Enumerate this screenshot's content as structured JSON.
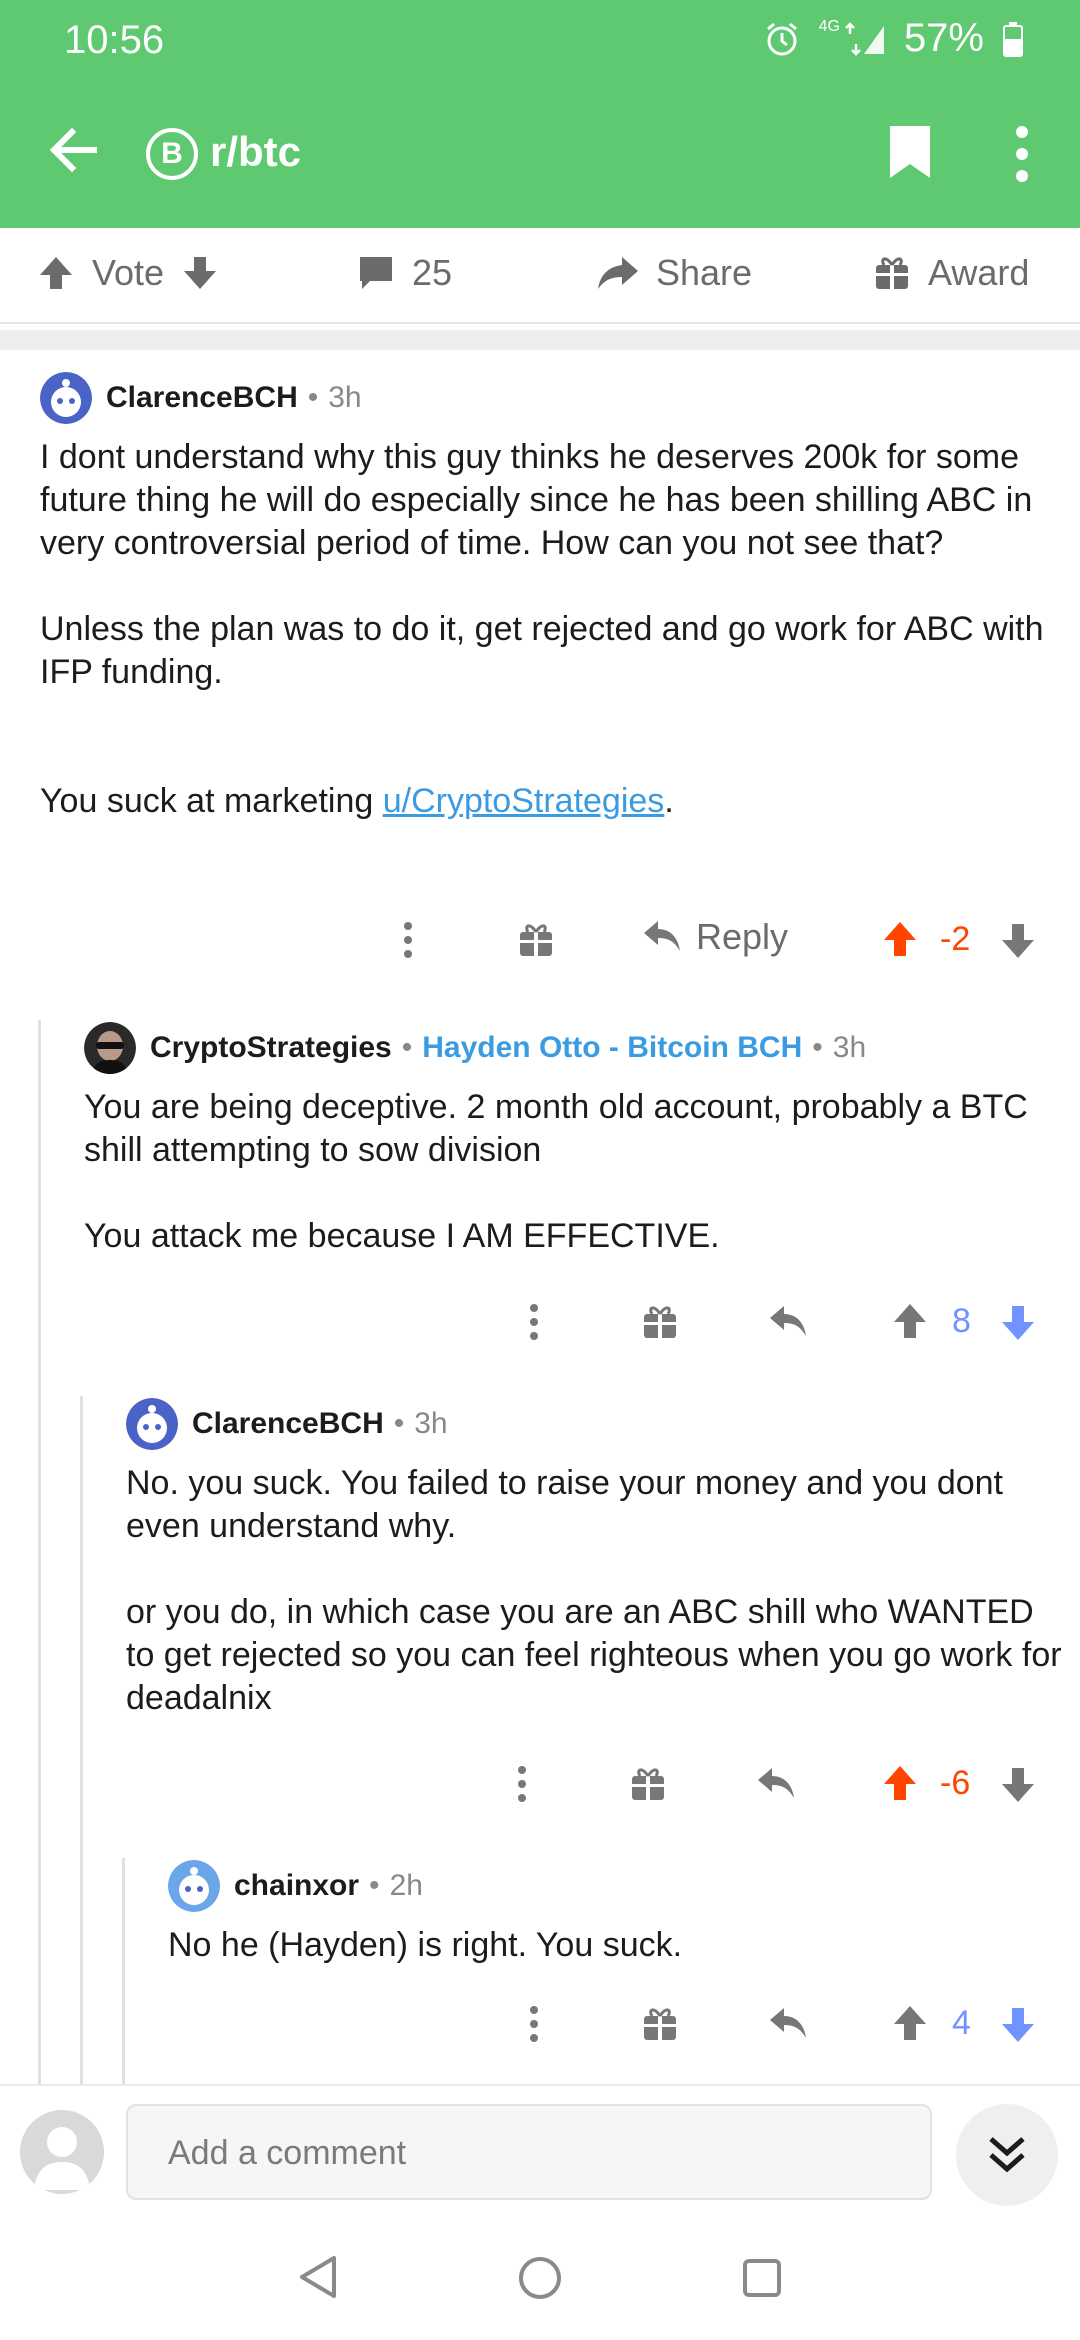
{
  "status_bar": {
    "time": "10:56",
    "network": "4G",
    "battery": "57%"
  },
  "header": {
    "subreddit": "r/btc",
    "sub_icon_letter": "B"
  },
  "action_bar": {
    "vote_label": "Vote",
    "comments_count": "25",
    "share_label": "Share",
    "award_label": "Award"
  },
  "comments": [
    {
      "author": "ClarenceBCH",
      "age": "3h",
      "paragraphs": [
        "I dont understand why this guy thinks he deserves 200k for some future thing he will do especially since he has been shilling ABC in very controversial period of time. How can you not see that?",
        "Unless the plan was to do it, get rejected and go work for ABC with IFP funding."
      ],
      "last_text": "You suck at marketing ",
      "last_link": "u/CryptoStrategies",
      "last_tail": ".",
      "reply_label": "Reply",
      "score": "-2"
    },
    {
      "author": "CryptoStrategies",
      "flair": "Hayden Otto - Bitcoin BCH",
      "age": "3h",
      "paragraphs": [
        "You are being deceptive. 2 month old account, probably a BTC shill attempting to sow division",
        "You attack me because I AM EFFECTIVE."
      ],
      "score": "8"
    },
    {
      "author": "ClarenceBCH",
      "age": "3h",
      "paragraphs": [
        "No. you suck. You failed to raise your money and you dont even understand why.",
        "or you do, in which case you are an ABC shill who WANTED to get rejected so you can feel righteous when you go work for deadalnix"
      ],
      "score": "-6"
    },
    {
      "author": "chainxor",
      "age": "2h",
      "paragraphs": [
        "No he (Hayden) is right. You suck."
      ],
      "score": "4"
    }
  ],
  "composer": {
    "placeholder": "Add a comment"
  },
  "colors": {
    "header_green": "#5ec971",
    "upvote_orange": "#ff4500",
    "downvote_blue": "#7193ff",
    "link_blue": "#3b9be0"
  }
}
